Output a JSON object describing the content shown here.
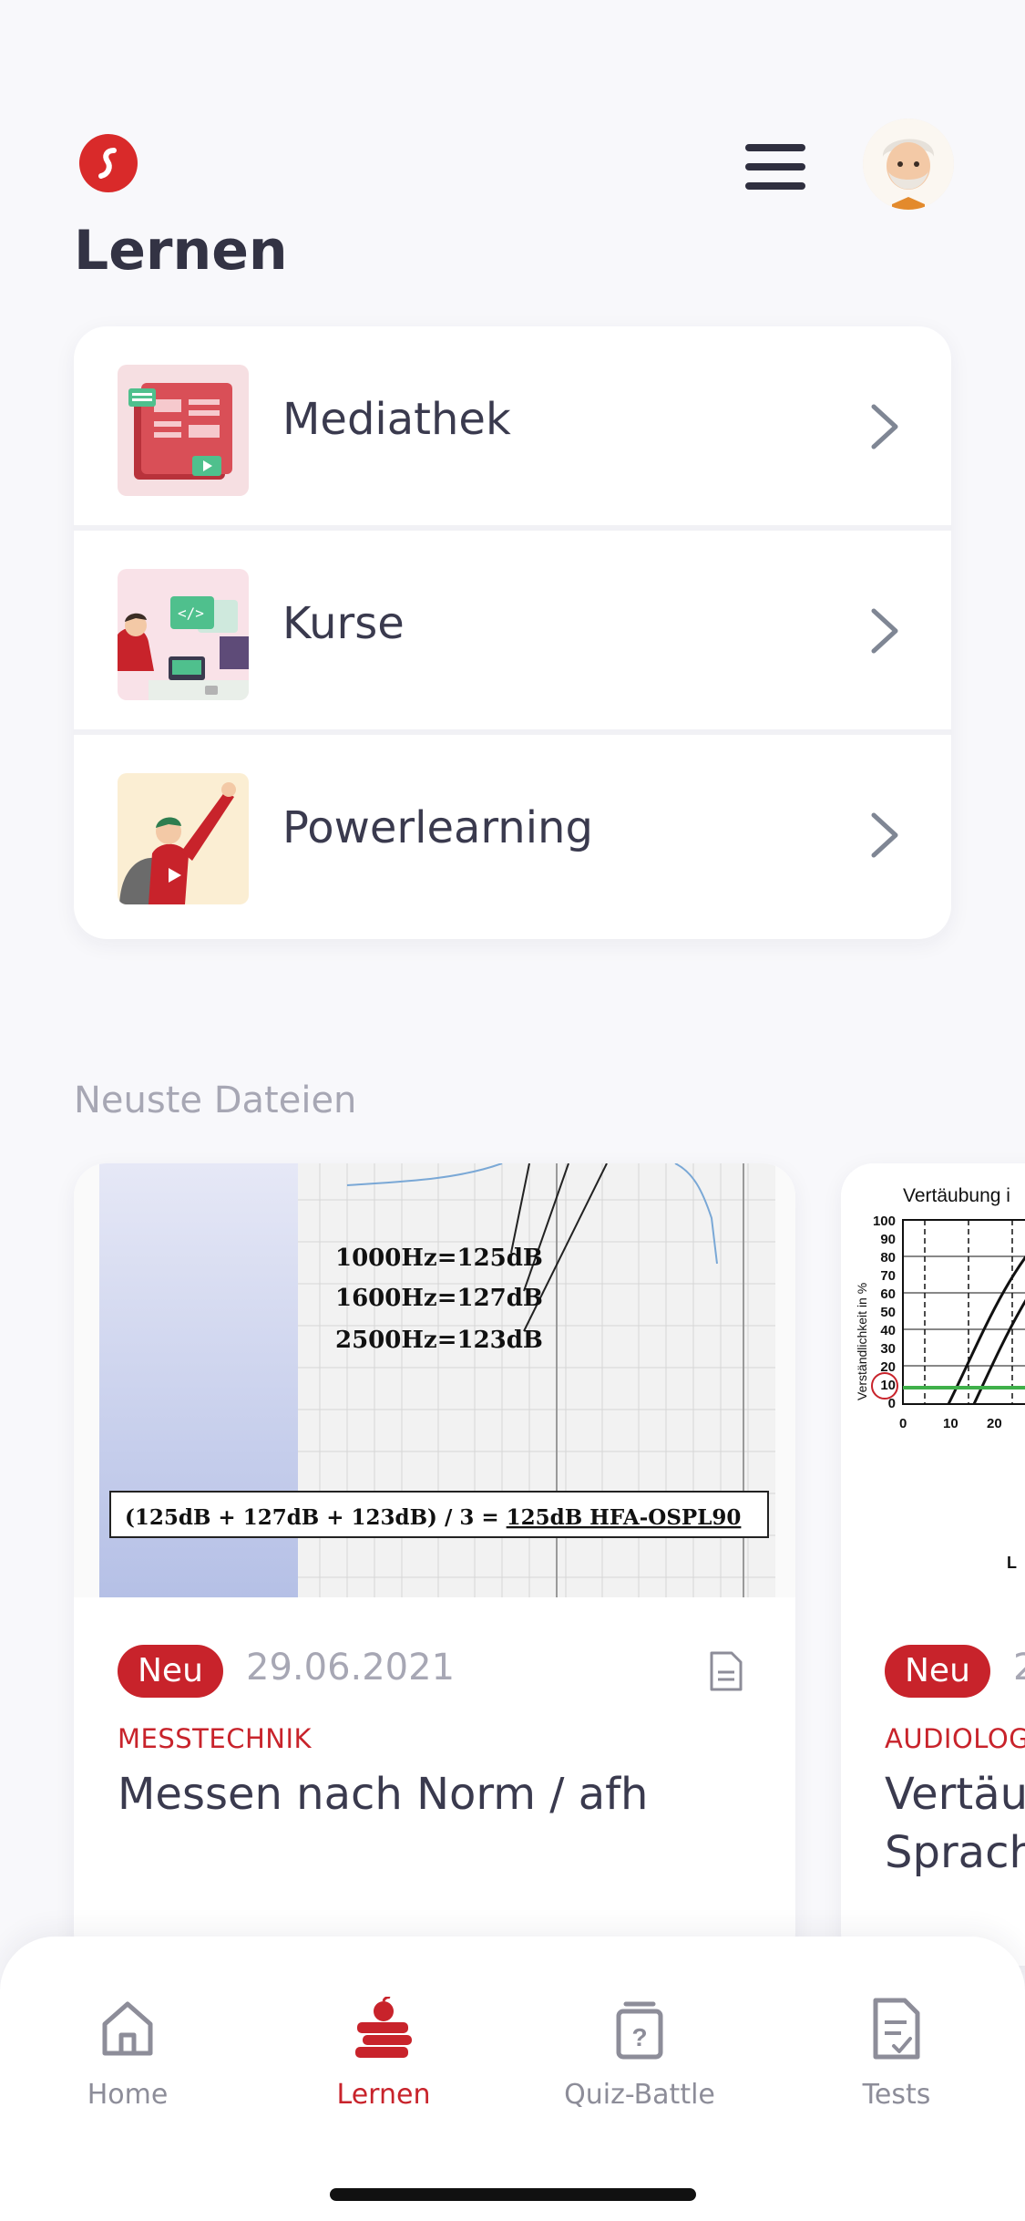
{
  "header": {
    "title": "Lernen",
    "logo_icon": "brand-logo-icon",
    "menu_icon": "hamburger-menu-icon",
    "avatar_icon": "user-avatar-icon"
  },
  "nav_items": [
    {
      "label": "Mediathek",
      "icon": "media-library-illustration"
    },
    {
      "label": "Kurse",
      "icon": "courses-illustration"
    },
    {
      "label": "Powerlearning",
      "icon": "powerlearning-illustration"
    }
  ],
  "recent_files": {
    "title": "Neuste Dateien",
    "items": [
      {
        "badge": "Neu",
        "date": "29.06.2021",
        "category": "MESSTECHNIK",
        "title": "Messen nach Norm / afh",
        "type_icon": "document-icon",
        "preview": {
          "line1": "1000Hz=125dB",
          "line2": "1600Hz=127dB",
          "line3": "2500Hz=123dB",
          "formula": "(125dB + 127dB + 123dB) / 3 = ",
          "formula_result": "125dB HFA-OSPL90"
        }
      },
      {
        "badge": "Neu",
        "date": "2",
        "category": "AUDIOLOG",
        "title": "Vertäu Sprach",
        "preview": {
          "title": "Vertäubung i",
          "ylabel": "Verständlichkeit  in %",
          "yticks": [
            "100",
            "90",
            "80",
            "70",
            "60",
            "50",
            "40",
            "30",
            "20",
            "10",
            "0"
          ],
          "xticks": [
            "0",
            "10",
            "20"
          ],
          "xlabel": "L"
        }
      }
    ]
  },
  "bottom_nav": [
    {
      "label": "Home",
      "icon": "home-icon",
      "active": false
    },
    {
      "label": "Lernen",
      "icon": "books-apple-icon",
      "active": true
    },
    {
      "label": "Quiz-Battle",
      "icon": "quiz-icon",
      "active": false
    },
    {
      "label": "Tests",
      "icon": "test-checklist-icon",
      "active": false
    }
  ],
  "colors": {
    "accent": "#c8232b",
    "background": "#f8f8fb",
    "text": "#3a3a4e",
    "muted": "#a7a7b4"
  }
}
